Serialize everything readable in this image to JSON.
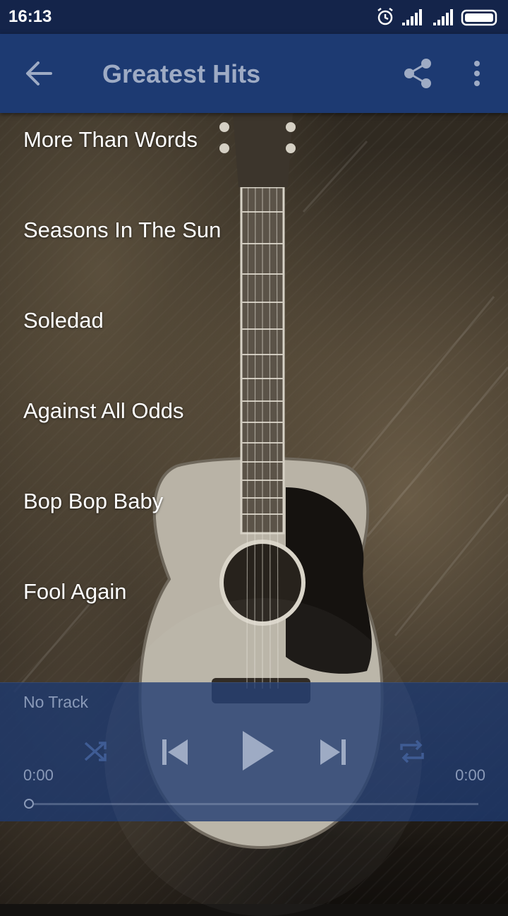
{
  "status_bar": {
    "time": "16:13",
    "icons": [
      "alarm-icon",
      "signal-icon",
      "signal-icon",
      "battery-icon"
    ]
  },
  "app_bar": {
    "title": "Greatest Hits",
    "icons": [
      "back-arrow-icon",
      "share-icon",
      "more-vert-icon"
    ]
  },
  "tracks": [
    {
      "label": "More Than Words"
    },
    {
      "label": "Seasons In The Sun"
    },
    {
      "label": "Soledad"
    },
    {
      "label": "Against All Odds"
    },
    {
      "label": "Bop Bop Baby"
    },
    {
      "label": "Fool Again"
    }
  ],
  "player": {
    "now_playing": "No Track",
    "elapsed": "0:00",
    "duration": "0:00",
    "progress": 0,
    "icons": [
      "shuffle-icon",
      "previous-icon",
      "play-icon",
      "next-icon",
      "repeat-icon"
    ]
  },
  "colors": {
    "status_bar": "#14244a",
    "app_bar": "#1d3a72",
    "title_text": "#9eabc4",
    "player_bg": "#1f396e",
    "player_text": "#8a9ab8"
  }
}
